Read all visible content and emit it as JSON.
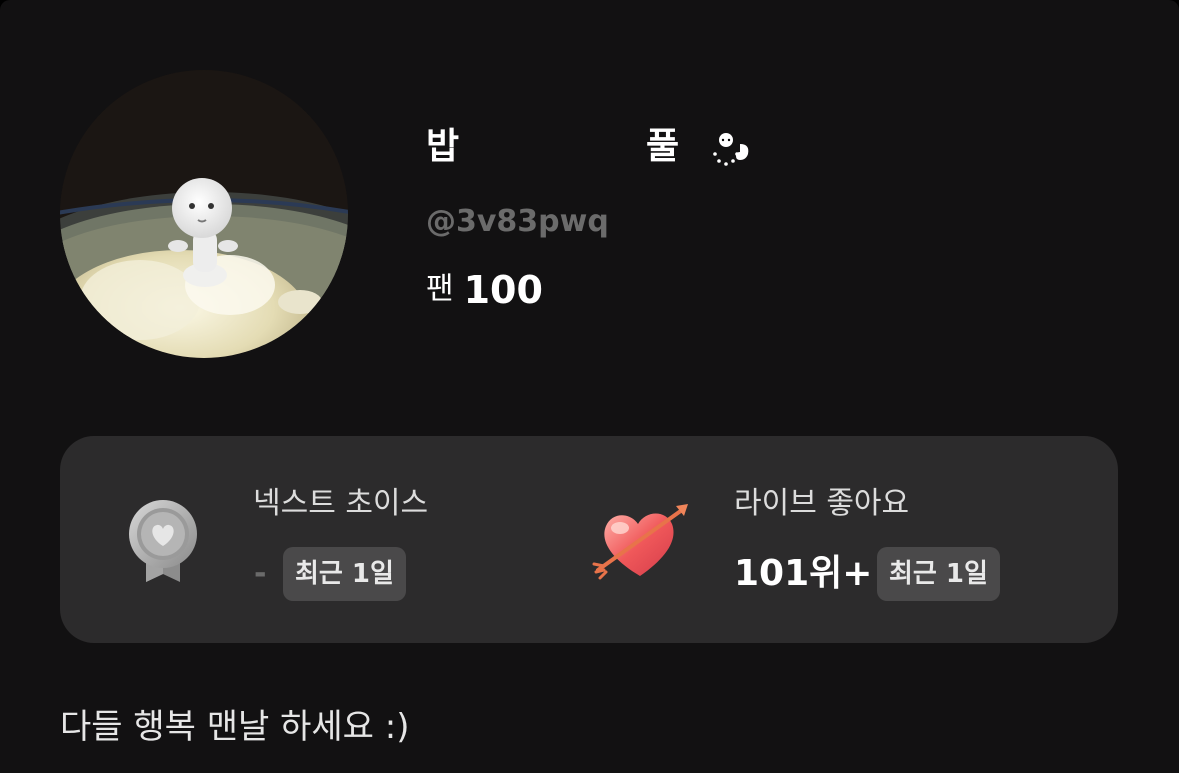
{
  "profile": {
    "name_first": "밥",
    "name_second": "풀",
    "name_emoji_icon": "hanging-baby-emoji-icon",
    "handle": "@3v83pwq",
    "fans_label": "팬",
    "fans_count": "100",
    "avatar_icon": "rice-bowl-figure-avatar"
  },
  "stats": {
    "next_choice": {
      "title": "넥스트 초이스",
      "value": "-",
      "badge": "최근 1일",
      "icon": "silver-heart-medal-icon"
    },
    "live_like": {
      "title": "라이브 좋아요",
      "value": "101위+",
      "badge": "최근 1일",
      "icon": "heart-arrow-icon"
    }
  },
  "bio": "다들 행복 맨날 하세요 :)",
  "colors": {
    "background": "#121112",
    "card": "#2c2b2c",
    "badge": "#4a494a",
    "muted_text": "#6b6b6b"
  }
}
